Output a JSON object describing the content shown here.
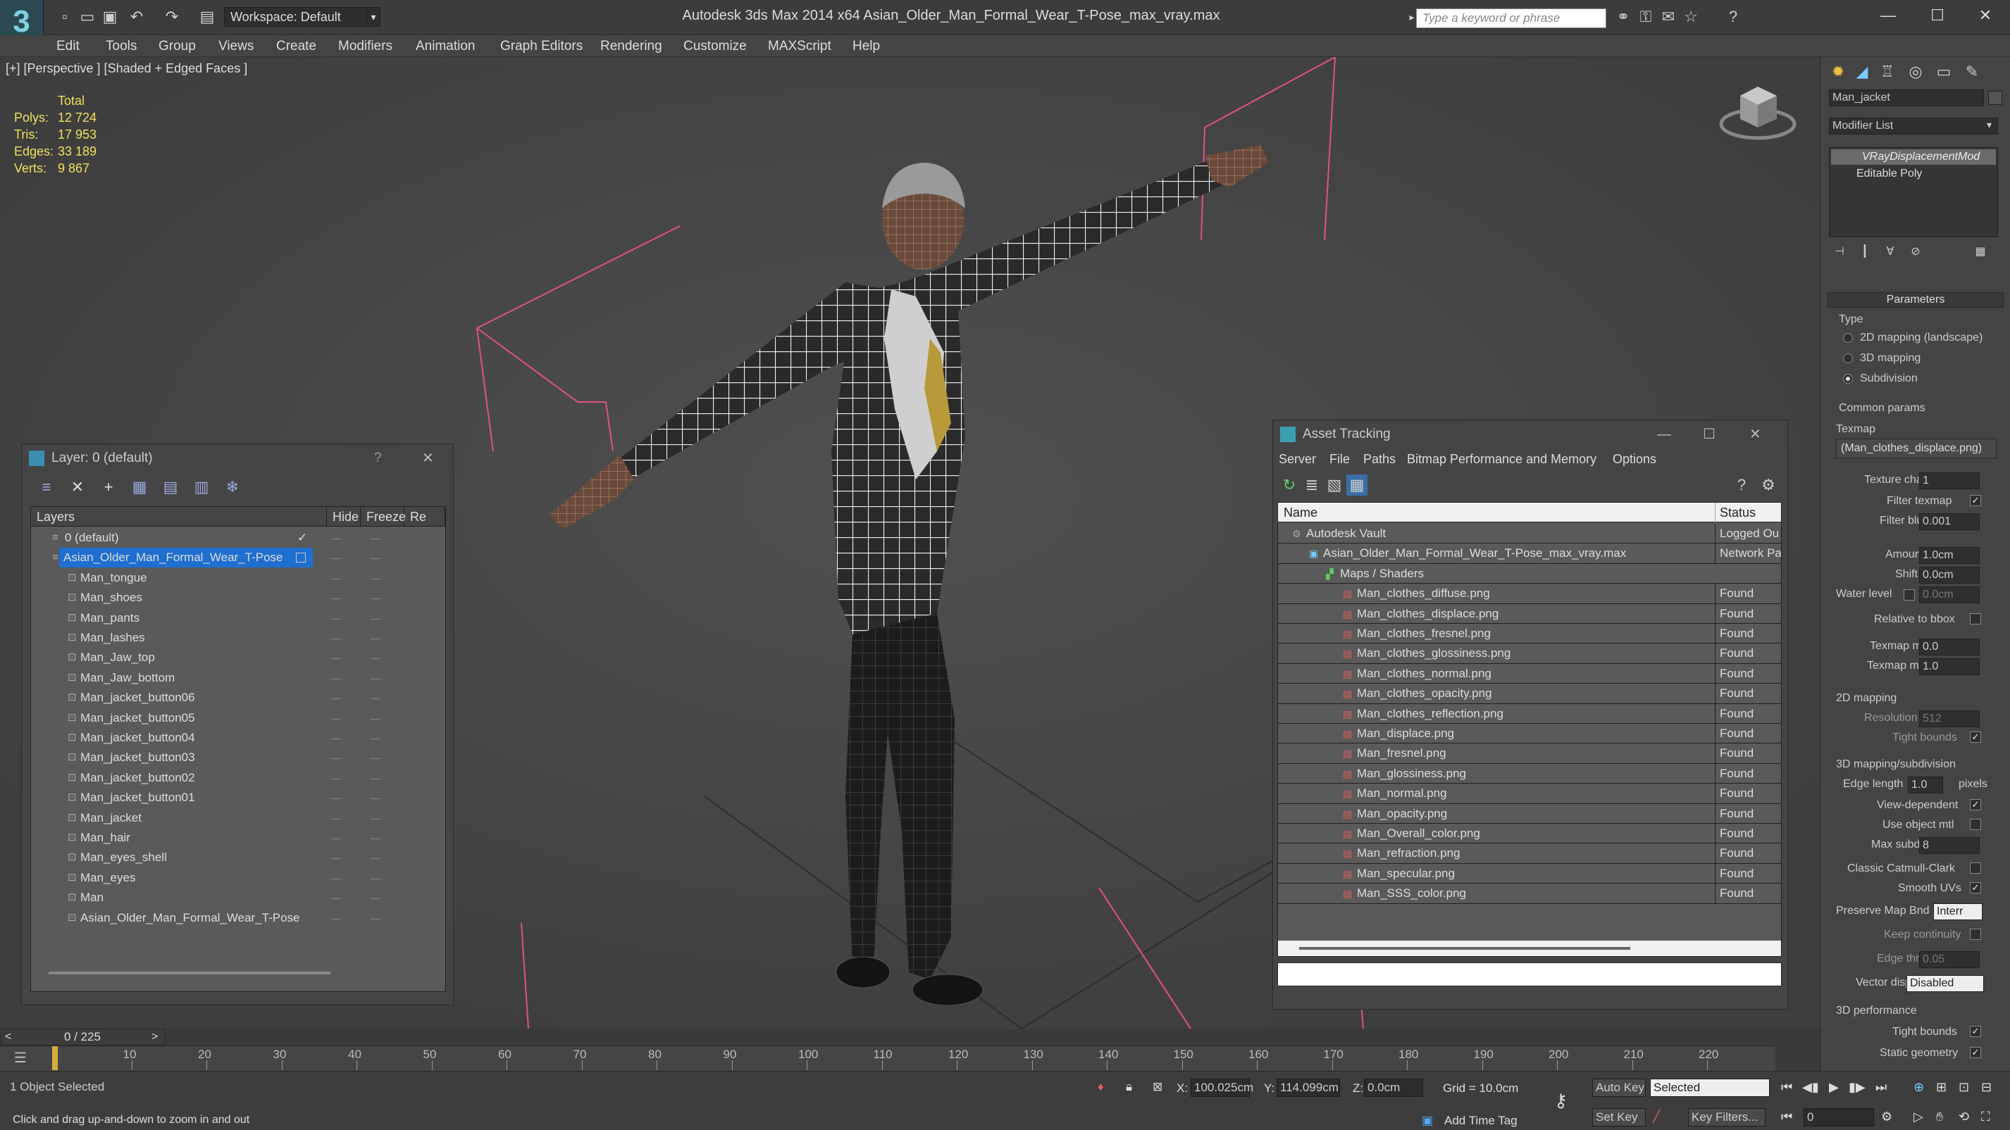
{
  "app": {
    "title": "Autodesk 3ds Max  2014 x64     Asian_Older_Man_Formal_Wear_T-Pose_max_vray.max",
    "workspace": "Workspace: Default",
    "search_placeholder": "Type a keyword or phrase",
    "logo_glyph": "3"
  },
  "menu": [
    "Edit",
    "Tools",
    "Group",
    "Views",
    "Create",
    "Modifiers",
    "Animation",
    "Graph Editors",
    "Rendering",
    "Customize",
    "MAXScript",
    "Help"
  ],
  "viewport": {
    "label": "[+] [Perspective ] [Shaded + Edged Faces ]",
    "stats": {
      "header": "Total",
      "rows": [
        {
          "label": "Polys:",
          "value": "12 724"
        },
        {
          "label": "Tris:",
          "value": "17 953"
        },
        {
          "label": "Edges:",
          "value": "33 189"
        },
        {
          "label": "Verts:",
          "value": "9 867"
        }
      ]
    }
  },
  "layer_dialog": {
    "title": "Layer: 0 (default)",
    "help": "?",
    "close": "✕",
    "columns": [
      "Layers",
      "Hide",
      "Freeze",
      "Re"
    ],
    "rows": [
      {
        "name": "0 (default)",
        "level": 0,
        "check": "✓"
      },
      {
        "name": "Asian_Older_Man_Formal_Wear_T-Pose",
        "level": 0,
        "selected": true
      },
      {
        "name": "Man_tongue",
        "level": 1
      },
      {
        "name": "Man_shoes",
        "level": 1
      },
      {
        "name": "Man_pants",
        "level": 1
      },
      {
        "name": "Man_lashes",
        "level": 1
      },
      {
        "name": "Man_Jaw_top",
        "level": 1
      },
      {
        "name": "Man_Jaw_bottom",
        "level": 1
      },
      {
        "name": "Man_jacket_button06",
        "level": 1
      },
      {
        "name": "Man_jacket_button05",
        "level": 1
      },
      {
        "name": "Man_jacket_button04",
        "level": 1
      },
      {
        "name": "Man_jacket_button03",
        "level": 1
      },
      {
        "name": "Man_jacket_button02",
        "level": 1
      },
      {
        "name": "Man_jacket_button01",
        "level": 1
      },
      {
        "name": "Man_jacket",
        "level": 1
      },
      {
        "name": "Man_hair",
        "level": 1
      },
      {
        "name": "Man_eyes_shell",
        "level": 1
      },
      {
        "name": "Man_eyes",
        "level": 1
      },
      {
        "name": "Man",
        "level": 1
      },
      {
        "name": "Asian_Older_Man_Formal_Wear_T-Pose",
        "level": 1
      }
    ]
  },
  "asset_dialog": {
    "title": "Asset Tracking",
    "menu": [
      "Server",
      "File",
      "Paths",
      "Bitmap Performance and Memory",
      "Options"
    ],
    "columns": [
      "Name",
      "Status"
    ],
    "rows": [
      {
        "name": "Autodesk Vault",
        "status": "Logged Ou",
        "indent": 0,
        "kind": "vault"
      },
      {
        "name": "Asian_Older_Man_Formal_Wear_T-Pose_max_vray.max",
        "status": "Network Pa",
        "indent": 1,
        "kind": "file"
      },
      {
        "name": "Maps / Shaders",
        "status": "",
        "indent": 2,
        "kind": "folder"
      },
      {
        "name": "Man_clothes_diffuse.png",
        "status": "Found",
        "indent": 3,
        "kind": "png"
      },
      {
        "name": "Man_clothes_displace.png",
        "status": "Found",
        "indent": 3,
        "kind": "png"
      },
      {
        "name": "Man_clothes_fresnel.png",
        "status": "Found",
        "indent": 3,
        "kind": "png"
      },
      {
        "name": "Man_clothes_glossiness.png",
        "status": "Found",
        "indent": 3,
        "kind": "png"
      },
      {
        "name": "Man_clothes_normal.png",
        "status": "Found",
        "indent": 3,
        "kind": "png"
      },
      {
        "name": "Man_clothes_opacity.png",
        "status": "Found",
        "indent": 3,
        "kind": "png"
      },
      {
        "name": "Man_clothes_reflection.png",
        "status": "Found",
        "indent": 3,
        "kind": "png"
      },
      {
        "name": "Man_displace.png",
        "status": "Found",
        "indent": 3,
        "kind": "png"
      },
      {
        "name": "Man_fresnel.png",
        "status": "Found",
        "indent": 3,
        "kind": "png"
      },
      {
        "name": "Man_glossiness.png",
        "status": "Found",
        "indent": 3,
        "kind": "png"
      },
      {
        "name": "Man_normal.png",
        "status": "Found",
        "indent": 3,
        "kind": "png"
      },
      {
        "name": "Man_opacity.png",
        "status": "Found",
        "indent": 3,
        "kind": "png"
      },
      {
        "name": "Man_Overall_color.png",
        "status": "Found",
        "indent": 3,
        "kind": "png"
      },
      {
        "name": "Man_refraction.png",
        "status": "Found",
        "indent": 3,
        "kind": "png"
      },
      {
        "name": "Man_specular.png",
        "status": "Found",
        "indent": 3,
        "kind": "png"
      },
      {
        "name": "Man_SSS_color.png",
        "status": "Found",
        "indent": 3,
        "kind": "png"
      }
    ]
  },
  "command_panel": {
    "object_name": "Man_jacket",
    "modifier_list": "Modifier List",
    "stack": [
      "VRayDisplacementMod",
      "Editable Poly"
    ],
    "rollout": "Parameters",
    "type_label": "Type",
    "type_options": [
      "2D mapping (landscape)",
      "3D mapping",
      "Subdivision"
    ],
    "common_params": "Common params",
    "texmap_label": "Texmap",
    "texmap_value": "(Man_clothes_displace.png)",
    "texture_chan_label": "Texture chan",
    "texture_chan_value": "1",
    "filter_texmap": "Filter texmap",
    "filter_blur_label": "Filter blur",
    "filter_blur_value": "0.001",
    "amount_label": "Amount",
    "amount_value": "1.0cm",
    "shift_label": "Shift",
    "shift_value": "0.0cm",
    "water_level_label": "Water level",
    "water_level_value": "0.0cm",
    "relative_bbox": "Relative to bbox",
    "texmap_min_label": "Texmap min",
    "texmap_min_value": "0.0",
    "texmap_max_label": "Texmap max",
    "texmap_max_value": "1.0",
    "mapping_2d": "2D mapping",
    "resolution_label": "Resolution",
    "resolution_value": "512",
    "tight_bounds": "Tight bounds",
    "mapping_3d": "3D mapping/subdivision",
    "edge_length_label": "Edge length",
    "edge_length_value": "1.0",
    "pixels": "pixels",
    "view_dependent": "View-dependent",
    "use_object_mtl": "Use object mtl",
    "max_subdivs_label": "Max subdivs",
    "max_subdivs_value": "8",
    "classic_catmull": "Classic Catmull-Clark",
    "smooth_uvs": "Smooth UVs",
    "preserve_map_label": "Preserve Map Bnd",
    "preserve_map_value": "Interr",
    "keep_continuity": "Keep continuity",
    "edge_thresh_label": "Edge thresh",
    "edge_thresh_value": "0.05",
    "vector_displ_label": "Vector displ",
    "vector_displ_value": "Disabled",
    "perf_3d": "3D performance",
    "tight_bounds2": "Tight bounds",
    "static_geometry": "Static geometry"
  },
  "timeline": {
    "frame": "0 / 225",
    "ticks": [
      "10",
      "20",
      "30",
      "40",
      "50",
      "60",
      "70",
      "80",
      "90",
      "100",
      "110",
      "120",
      "130",
      "140",
      "150",
      "160",
      "170",
      "180",
      "190",
      "200",
      "210",
      "220"
    ]
  },
  "status": {
    "selection": "1 Object Selected",
    "prompt": "Click and drag up-and-down to zoom in and out",
    "x_label": "X:",
    "x_value": "100.025cm",
    "y_label": "Y:",
    "y_value": "114.099cm",
    "z_label": "Z:",
    "z_value": "0.0cm",
    "grid": "Grid = 10.0cm",
    "auto_key": "Auto Key",
    "selected": "Selected",
    "set_key": "Set Key",
    "key_filters": "Key Filters...",
    "add_time_tag": "Add Time Tag",
    "frame_value": "0"
  },
  "colors": {
    "bg": "#444444",
    "viewport": "#4a4a4a",
    "selection": "#1e6fd0",
    "stats_text": "#f0e060",
    "gizmo": "#e0508a"
  }
}
